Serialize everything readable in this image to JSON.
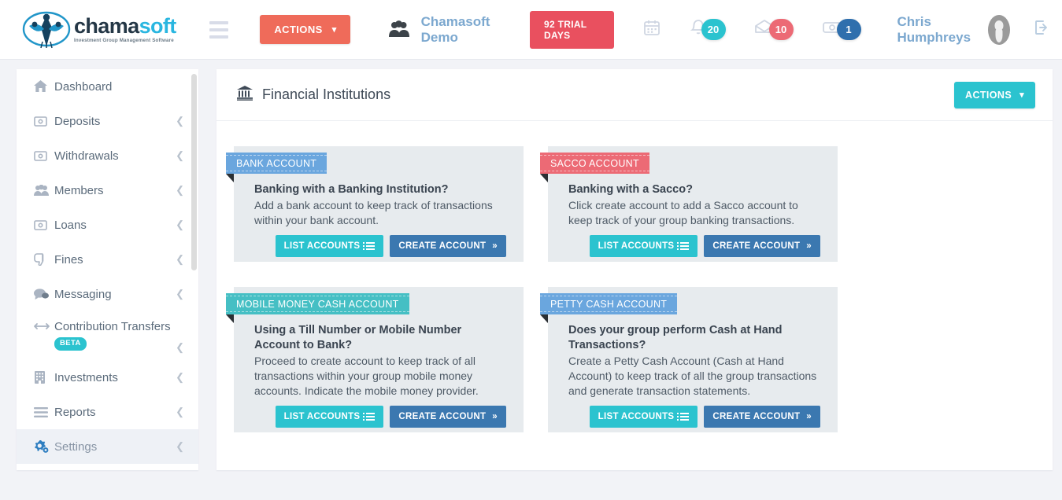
{
  "topbar": {
    "logo": {
      "word_dark": "chama",
      "word_blue": "soft",
      "tagline": "Investment Group Management Software",
      "icon": "chamasoft-logo-icon"
    },
    "menu_icon": "hamburger-icon",
    "actions_label": "ACTIONS",
    "group_icon": "group-people-icon",
    "group_name": "Chamasoft Demo",
    "trial_badge": "92 TRIAL DAYS",
    "icons": [
      {
        "name": "calendar-icon",
        "badge": null,
        "badge_color": null
      },
      {
        "name": "bell-icon",
        "badge": "20",
        "badge_color": "#2bc3cf"
      },
      {
        "name": "envelope-icon",
        "badge": "10",
        "badge_color": "#ec6a75"
      },
      {
        "name": "money-icon",
        "badge": "1",
        "badge_color": "#2f6fad"
      }
    ],
    "user_name": "Chris Humphreys",
    "avatar_icon": "user-avatar-icon",
    "logout_icon": "logout-icon"
  },
  "sidebar": {
    "items": [
      {
        "label": "Dashboard",
        "icon": "home-icon",
        "chevron": false,
        "active": false,
        "badge": null
      },
      {
        "label": "Deposits",
        "icon": "money-icon",
        "chevron": true,
        "active": false,
        "badge": null
      },
      {
        "label": "Withdrawals",
        "icon": "money-icon",
        "chevron": true,
        "active": false,
        "badge": null
      },
      {
        "label": "Members",
        "icon": "people-icon",
        "chevron": true,
        "active": false,
        "badge": null
      },
      {
        "label": "Loans",
        "icon": "money-icon",
        "chevron": true,
        "active": false,
        "badge": null
      },
      {
        "label": "Fines",
        "icon": "thumbs-down-icon",
        "chevron": true,
        "active": false,
        "badge": null
      },
      {
        "label": "Messaging",
        "icon": "chat-bubbles-icon",
        "chevron": true,
        "active": false,
        "badge": null
      },
      {
        "label": "Contribution Transfers",
        "icon": "arrows-left-right-icon",
        "chevron": true,
        "active": false,
        "badge": "BETA"
      },
      {
        "label": "Investments",
        "icon": "building-icon",
        "chevron": true,
        "active": false,
        "badge": null
      },
      {
        "label": "Reports",
        "icon": "list-lines-icon",
        "chevron": true,
        "active": false,
        "badge": null
      },
      {
        "label": "Settings",
        "icon": "gears-icon",
        "chevron": true,
        "active": true,
        "badge": null
      }
    ],
    "scrollbar": "sidebar-scrollbar"
  },
  "panel": {
    "title": "Financial Institutions",
    "title_icon": "bank-icon",
    "actions_label": "ACTIONS",
    "cards": [
      {
        "ribbon": "BANK ACCOUNT",
        "ribbon_color": "#6aa6de",
        "question": "Banking with a Banking Institution?",
        "description": "Add a bank account to keep track of transactions within your bank account.",
        "list_label": "LIST ACCOUNTS",
        "create_label": "CREATE ACCOUNT"
      },
      {
        "ribbon": "SACCO ACCOUNT",
        "ribbon_color": "#ec6a75",
        "question": "Banking with a Sacco?",
        "description": "Click create account to add a Sacco account to keep track of your group banking transactions.",
        "list_label": "LIST ACCOUNTS",
        "create_label": "CREATE ACCOUNT"
      },
      {
        "ribbon": "MOBILE MONEY CASH ACCOUNT",
        "ribbon_color": "#45bfc4",
        "question": "Using a Till Number or Mobile Number Account to Bank?",
        "description": "Proceed to create account to keep track of all transactions within your group mobile money accounts. Indicate the mobile money provider.",
        "list_label": "LIST ACCOUNTS",
        "create_label": "CREATE ACCOUNT"
      },
      {
        "ribbon": "PETTY CASH ACCOUNT",
        "ribbon_color": "#6aa6de",
        "question": "Does your group perform Cash at Hand Transactions?",
        "description": "Create a Petty Cash Account (Cash at Hand Account) to keep track of all the group transactions and generate transaction statements.",
        "list_label": "LIST ACCOUNTS",
        "create_label": "CREATE ACCOUNT"
      }
    ]
  },
  "colors": {
    "brand_coral": "#ef6b5a",
    "brand_teal": "#2bc3cf",
    "brand_blue": "#3b78b0",
    "page_bg": "#f2f3f7"
  }
}
